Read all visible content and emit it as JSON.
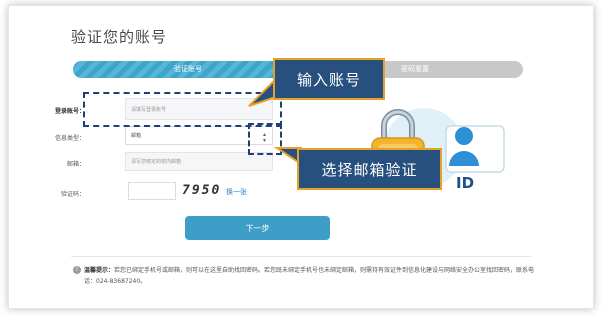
{
  "page": {
    "title": "验证您的账号"
  },
  "steps": [
    {
      "label": "验证账号",
      "active": true
    },
    {
      "label": "密码重置",
      "active": false
    }
  ],
  "form": {
    "account": {
      "label": "登录账号：",
      "placeholder": "请填写登录账号"
    },
    "type": {
      "label": "信息类型：",
      "value": "邮箱"
    },
    "email": {
      "label": "邮箱：",
      "placeholder": "请写您绑定的校内邮箱"
    },
    "captcha": {
      "label": "验证码：",
      "code": "7950",
      "refresh": "换一张"
    }
  },
  "buttons": {
    "next": "下一步"
  },
  "tip": {
    "title": "温馨提示：",
    "text": "若您已绑定手机号或邮箱，则可以在这里自助找回密码。若您既未绑定手机号也未绑定邮箱，则需持有效证件到信息化建设与网络安全办公室找回密码，联系电话：024-83687240。"
  },
  "callouts": {
    "account": "输入账号",
    "email": "选择邮箱验证"
  },
  "illustration": {
    "id_text": "ID"
  },
  "colors": {
    "accent": "#3e9ec8",
    "callout_bg": "#27507f",
    "callout_border": "#e6a12b",
    "dash": "#1e3f78",
    "link": "#2e82c8"
  }
}
